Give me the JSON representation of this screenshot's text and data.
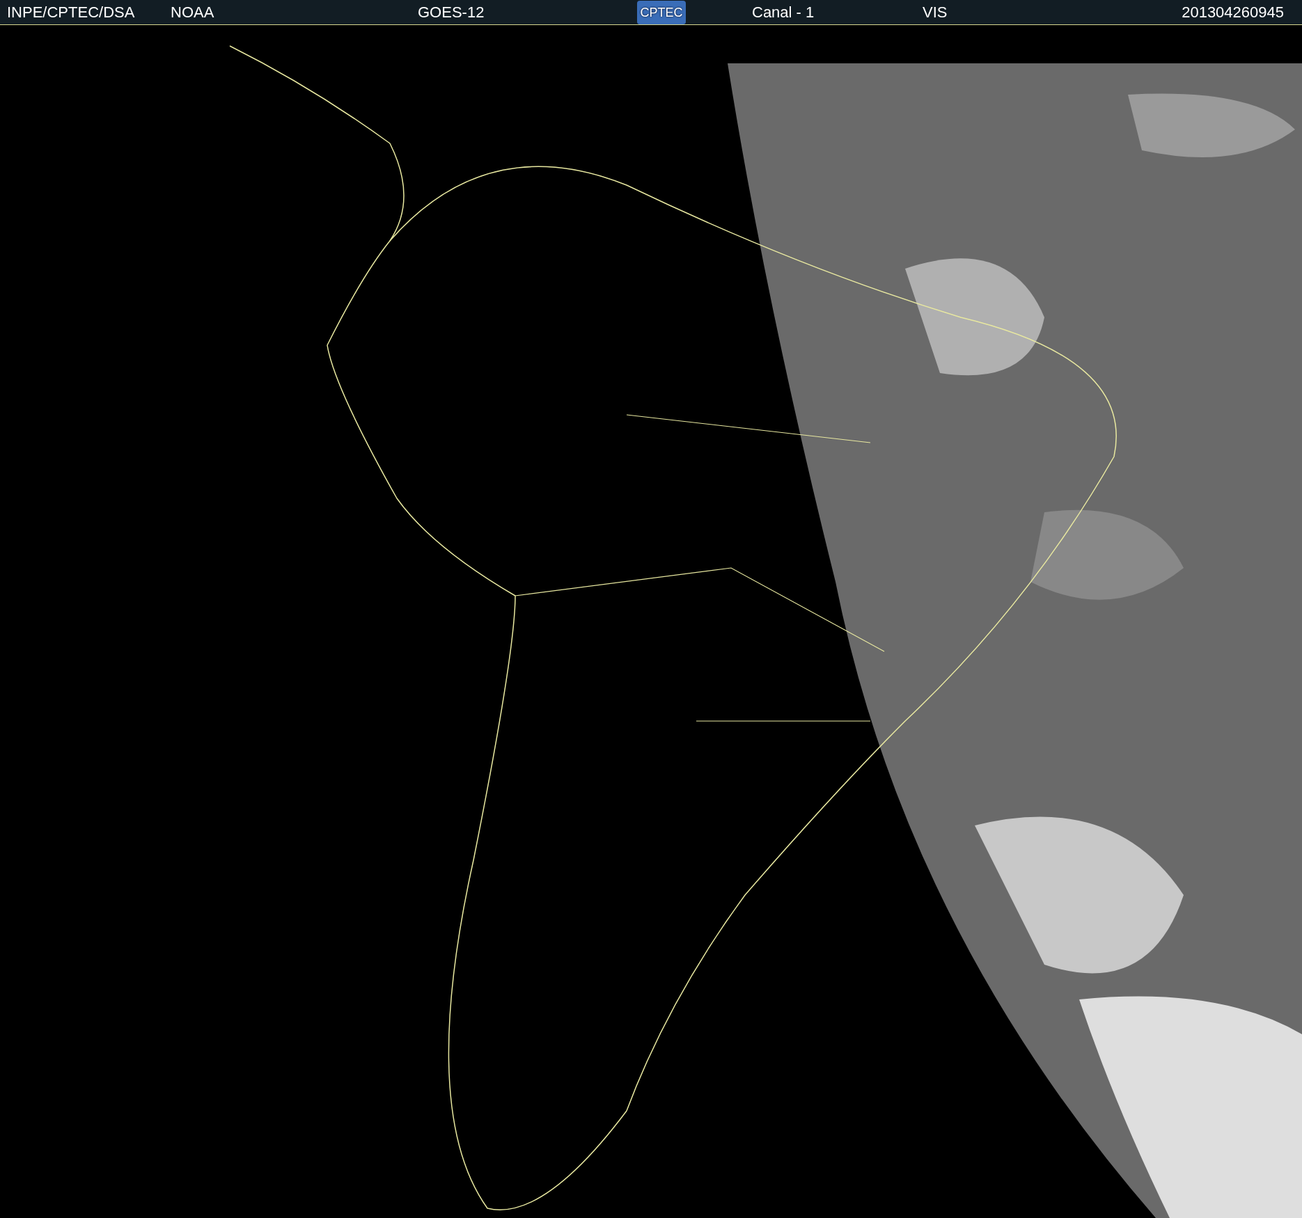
{
  "header": {
    "source": "INPE/CPTEC/DSA",
    "agency": "NOAA",
    "satellite": "GOES-12",
    "logo": "CPTEC",
    "channel": "Canal - 1",
    "band": "VIS",
    "timestamp": "201304260945"
  }
}
